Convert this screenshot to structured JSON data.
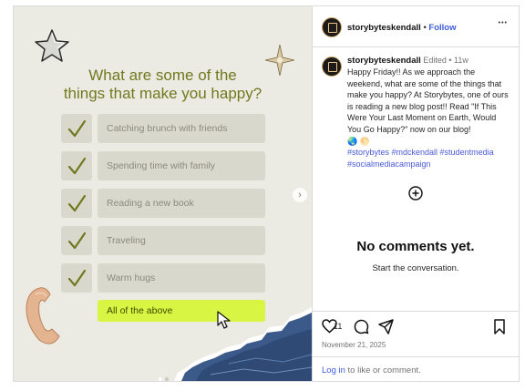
{
  "post": {
    "headline_line1": "What are some of the",
    "headline_line2": "things that make you happy?",
    "options": [
      "Catching brunch with friends",
      "Spending time with family",
      "Reading a new book",
      "Traveling",
      "Warm hugs"
    ],
    "highlight_option": "All of the above",
    "carousel_next_icon": "›",
    "carousel_count": 2,
    "carousel_active": 1
  },
  "header": {
    "username": "storybyteskendall",
    "separator": "•",
    "follow_label": "Follow",
    "more_icon": "•••"
  },
  "caption": {
    "username": "storybyteskendall",
    "edited": "Edited",
    "separator": "•",
    "age": "11w",
    "text": "Happy Friday!! As we approach the weekend, what are some of the things that make you happy? At Storybytes, one of ours is reading a new blog post!! Read \"If This Were Your Last Moment on Earth, Would You Go Happy?\" now on our blog!",
    "emoji": "🌏 🌕",
    "hashtags_line1": "#storybytes #mdckendall #studentmedia",
    "hashtags_line2": "#socialmediacampaign"
  },
  "comments": {
    "empty_title": "No comments yet.",
    "empty_subtitle": "Start the conversation."
  },
  "actions": {
    "like_count": "11",
    "date": "November 21, 2025",
    "login_link": "Log in",
    "login_suffix": " to like or comment."
  },
  "colors": {
    "headline": "#6f7a1f",
    "check": "#6f7a1f",
    "highlight": "#d7f542",
    "link": "#4a5bd8"
  }
}
